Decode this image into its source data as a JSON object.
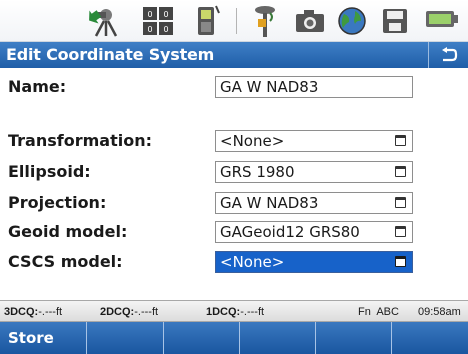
{
  "toolbar": {
    "icons": [
      "survey-instrument-icon",
      "keypad-icon",
      "controller-icon",
      "gps-rover-icon",
      "camera-icon",
      "globe-icon",
      "save-icon",
      "battery-icon"
    ]
  },
  "titlebar": {
    "title": "Edit Coordinate System"
  },
  "form": {
    "name_label": "Name:",
    "name_value": "GA W NAD83",
    "transformation_label": "Transformation:",
    "transformation_value": "<None>",
    "ellipsoid_label": "Ellipsoid:",
    "ellipsoid_value": "GRS 1980",
    "projection_label": "Projection:",
    "projection_value": "GA W NAD83",
    "geoid_label": "Geoid model:",
    "geoid_value": "GAGeoid12 GRS80",
    "cscs_label": "CSCS model:",
    "cscs_value": "<None>"
  },
  "statusbar": {
    "dq3_label": "3DCQ:",
    "dq3_value": "-.---ft",
    "dq2_label": "2DCQ:",
    "dq2_value": "-.---ft",
    "dq1_label": "1DCQ:",
    "dq1_value": "-.---ft",
    "mode": "Fn  ABC",
    "time": "09:58am"
  },
  "softkeys": {
    "store_label": "Store"
  }
}
